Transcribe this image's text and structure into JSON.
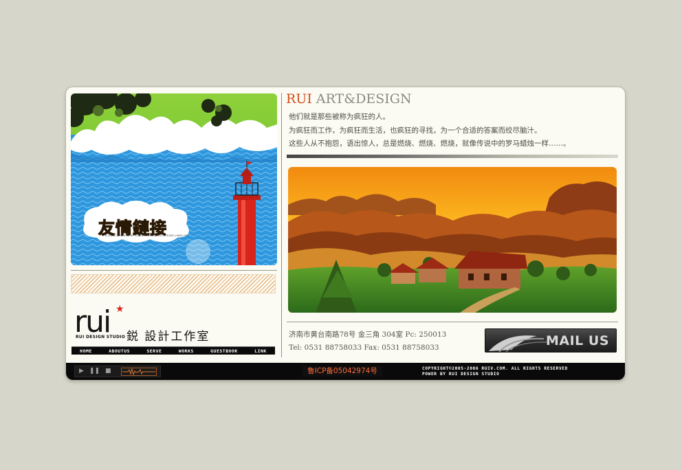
{
  "left": {
    "banner": {
      "title": "友情鏈接",
      "subtitle": "A LINKS WEB SITE BY RUI DESIGN STUDIO, PLEASE LINKS US!"
    },
    "logo": {
      "wordmark": "rui",
      "studio": "RUI DESIGN STUDIO",
      "cn_name": "鋭 設計工作室"
    },
    "nav": [
      "HOME",
      "ABOUTUS",
      "SERVE",
      "WORKS",
      "GUESTBOOK",
      "LINK"
    ]
  },
  "right": {
    "heading_rui": "RUI",
    "heading_rest": " ART&DESIGN",
    "intro": [
      "他们就是那些被称为疯狂的人。",
      "为疯狂而工作，为疯狂而生活，也疯狂的寻找，为一个合适的答案而绞尽脑汁。",
      "这些人从不抱怨，语出惊人，总是燃烧、燃烧、燃烧，就像传说中的罗马蜡烛一样……。"
    ],
    "contact": {
      "address": "济南市黄台南路78号 金三角 304室 Pc: 250013",
      "phone": "Tel: 0531 88758033 Fax: 0531 88758033"
    },
    "mail_button": "MAIL US"
  },
  "footer": {
    "icp": "鲁ICP备05042974号",
    "copyright_line1": "COPYRIGHT©2005-2006 RUIV.COM. ALL RIGHTS RESERVED",
    "copyright_line2": "POWER BY RUI DESIGN STUDIO"
  },
  "colors": {
    "page_bg": "#d6d6ca",
    "panel_bg": "#fbfbf3",
    "accent": "#d24a18",
    "footer_bg": "#0a0a0a",
    "icp_text": "#ff6a3a"
  }
}
